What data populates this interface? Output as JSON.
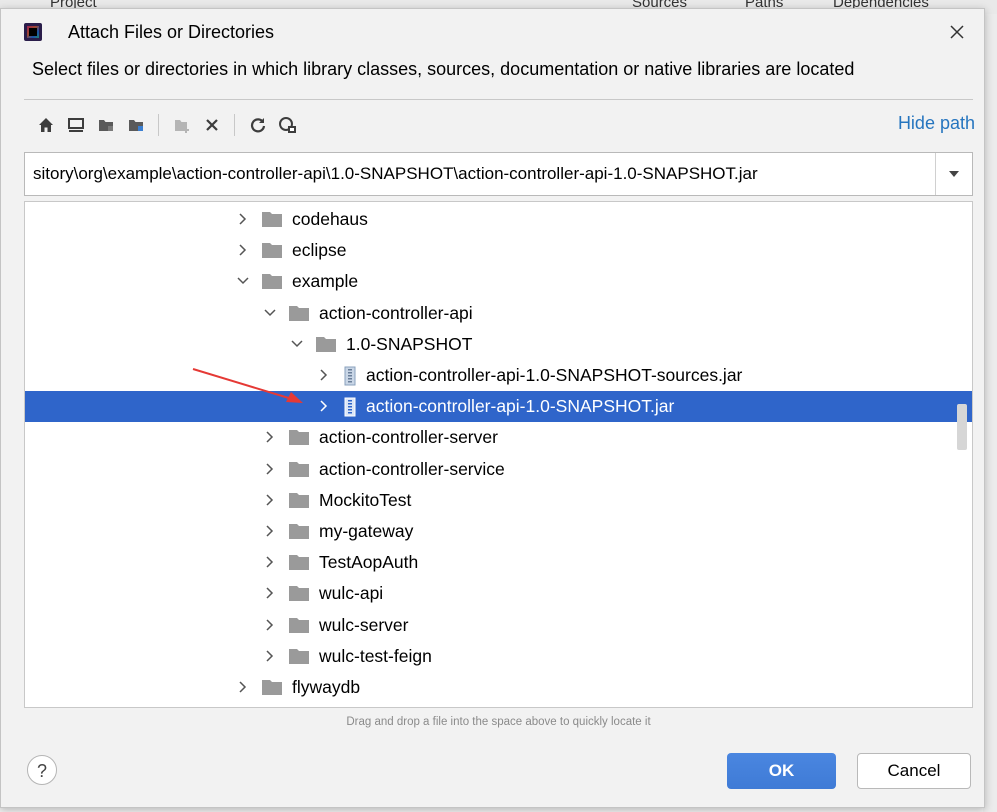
{
  "background": {
    "tabs": [
      "Project",
      "Sources",
      "Paths",
      "Dependencies"
    ]
  },
  "dialog": {
    "title": "Attach Files or Directories",
    "description": "Select files or directories in which library classes, sources, documentation or native libraries are located",
    "hide_path_label": "Hide path",
    "path_value": "sitory\\org\\example\\action-controller-api\\1.0-SNAPSHOT\\action-controller-api-1.0-SNAPSHOT.jar",
    "toolbar_icons": [
      "home-icon",
      "desktop-icon",
      "project-folder-icon",
      "module-folder-icon",
      "new-folder-icon",
      "delete-icon",
      "refresh-icon",
      "show-hidden-icon"
    ],
    "hint": "Drag and drop a file into the space above to quickly locate it",
    "ok_label": "OK",
    "cancel_label": "Cancel",
    "help_label": "?"
  },
  "tree": [
    {
      "label": "codehaus",
      "level": 0,
      "expanded": false,
      "type": "folder"
    },
    {
      "label": "eclipse",
      "level": 0,
      "expanded": false,
      "type": "folder"
    },
    {
      "label": "example",
      "level": 0,
      "expanded": true,
      "type": "folder"
    },
    {
      "label": "action-controller-api",
      "level": 1,
      "expanded": true,
      "type": "folder"
    },
    {
      "label": "1.0-SNAPSHOT",
      "level": 2,
      "expanded": true,
      "type": "folder"
    },
    {
      "label": "action-controller-api-1.0-SNAPSHOT-sources.jar",
      "level": 3,
      "expanded": false,
      "type": "jar"
    },
    {
      "label": "action-controller-api-1.0-SNAPSHOT.jar",
      "level": 3,
      "expanded": false,
      "type": "jar",
      "selected": true
    },
    {
      "label": "action-controller-server",
      "level": 1,
      "expanded": false,
      "type": "folder"
    },
    {
      "label": "action-controller-service",
      "level": 1,
      "expanded": false,
      "type": "folder"
    },
    {
      "label": "MockitoTest",
      "level": 1,
      "expanded": false,
      "type": "folder"
    },
    {
      "label": "my-gateway",
      "level": 1,
      "expanded": false,
      "type": "folder"
    },
    {
      "label": "TestAopAuth",
      "level": 1,
      "expanded": false,
      "type": "folder"
    },
    {
      "label": "wulc-api",
      "level": 1,
      "expanded": false,
      "type": "folder"
    },
    {
      "label": "wulc-server",
      "level": 1,
      "expanded": false,
      "type": "folder"
    },
    {
      "label": "wulc-test-feign",
      "level": 1,
      "expanded": false,
      "type": "folder"
    },
    {
      "label": "flywaydb",
      "level": 0,
      "expanded": false,
      "type": "folder"
    }
  ],
  "colors": {
    "selection": "#2f65ca",
    "link": "#2675bf",
    "ok_button": "#3f7bd6",
    "annotation_arrow": "#e53935"
  }
}
